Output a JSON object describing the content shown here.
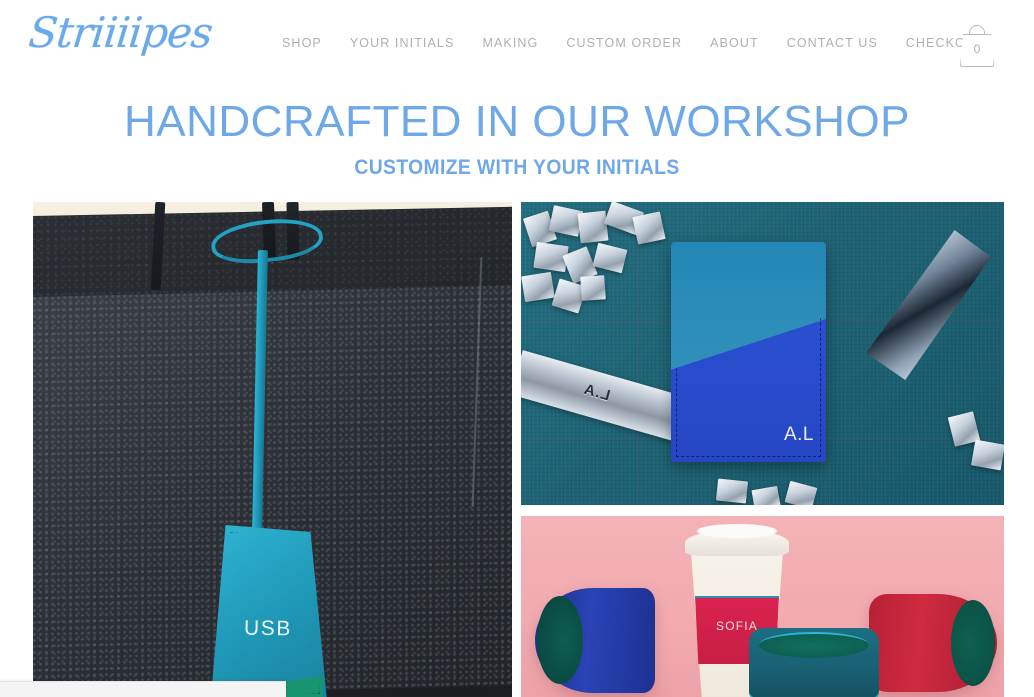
{
  "site": {
    "brand": "Striiiipes",
    "brand_color": "#6aa9ea"
  },
  "nav": {
    "items": [
      {
        "label": "SHOP"
      },
      {
        "label": "YOUR INITIALS"
      },
      {
        "label": "MAKING"
      },
      {
        "label": "CUSTOM ORDER"
      },
      {
        "label": "ABOUT"
      },
      {
        "label": "CONTACT US"
      },
      {
        "label": "CHECKOUT"
      }
    ],
    "cart": {
      "icon": "shopping-bag-icon",
      "count": "0"
    }
  },
  "hero": {
    "title": "HANDCRAFTED IN OUR WORKSHOP",
    "subtitle": "CUSTOMIZE WITH YOUR INITIALS",
    "title_color": "#6fa8e8"
  },
  "gallery": {
    "tiles": [
      {
        "name": "leather-bag-usb-tag",
        "caption": "USB",
        "monogram": "USB",
        "accent_color": "#1f97b6"
      },
      {
        "name": "passport-holder",
        "monogram": "A.L",
        "stamp_letters": "L.A",
        "accent_color": "#2547c4"
      },
      {
        "name": "coffee-cup-sleeves",
        "monogram": "SOFIA",
        "accent_color": "#c71e45"
      }
    ]
  }
}
